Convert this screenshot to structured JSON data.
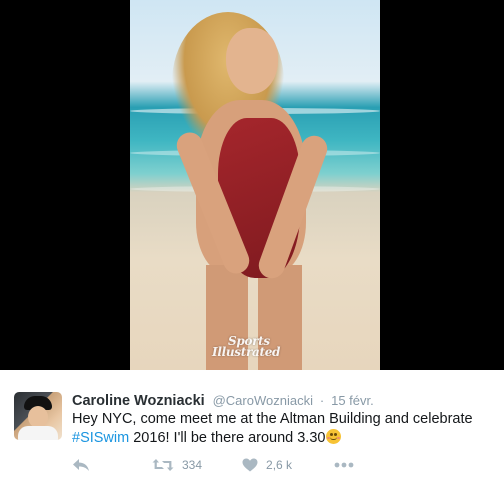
{
  "media": {
    "watermark_line1": "Sports",
    "watermark_line2": "Illustrated",
    "background_color": "#000000"
  },
  "tweet": {
    "display_name": "Caroline Wozniacki",
    "handle": "@CaroWozniacki",
    "separator": "·",
    "timestamp": "15 févr.",
    "text_part1": "Hey NYC, come meet me at the Altman Building and celebrate",
    "hashtag": "#SISwim",
    "text_part2": " 2016! I'll be there around 3.30",
    "emoji": "smiling-face-with-smiling-eyes",
    "hashtag_color": "#1b95e0"
  },
  "actions": {
    "reply_icon": "reply-icon",
    "retweet_icon": "retweet-icon",
    "retweet_count": "334",
    "like_icon": "heart-icon",
    "like_count": "2,6 k",
    "more_icon": "more-dots-icon"
  }
}
